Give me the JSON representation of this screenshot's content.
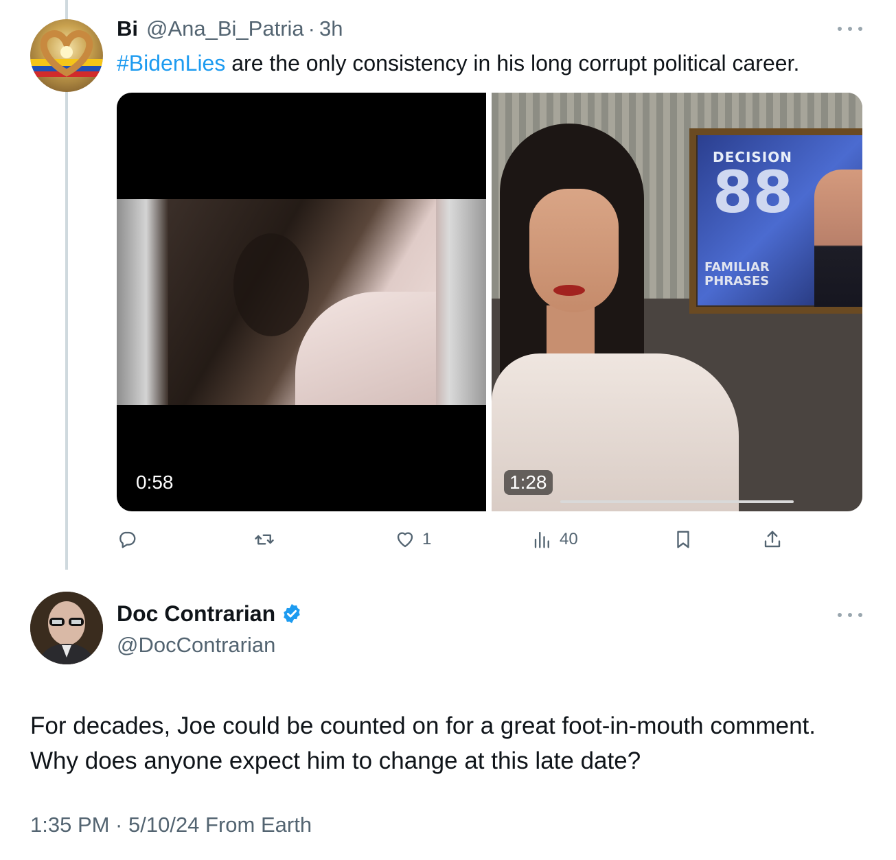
{
  "parent_tweet": {
    "author": {
      "name": "Bi",
      "handle": "@Ana_Bi_Patria",
      "avatar_icon": "heart-hands-flag-avatar"
    },
    "separator": "·",
    "time": "3h",
    "hashtag": "#BidenLies",
    "text": " are the only consistency in his long corrupt political career.",
    "media": [
      {
        "duration": "0:58"
      },
      {
        "duration": "1:28",
        "screen_text_top": "DECISION",
        "screen_text_number": "88",
        "screen_caption_line1": "FAMILIAR",
        "screen_caption_line2": "PHRASES"
      }
    ],
    "actions": {
      "reply_count": "",
      "retweet_count": "",
      "like_count": "1",
      "views_count": "40"
    }
  },
  "reply_tweet": {
    "author": {
      "name": "Doc Contrarian",
      "handle": "@DocContrarian",
      "verified": true,
      "avatar_icon": "elderly-man-glasses-avatar"
    },
    "text": "For decades, Joe could be counted on for a great foot-in-mouth comment. Why does anyone expect him to change at this late date?",
    "meta": "1:35 PM · 5/10/24 From Earth"
  },
  "colors": {
    "accent": "#1d9bf0",
    "secondary_text": "#536471",
    "primary_text": "#0f1419",
    "thread_line": "#cfd9de"
  }
}
